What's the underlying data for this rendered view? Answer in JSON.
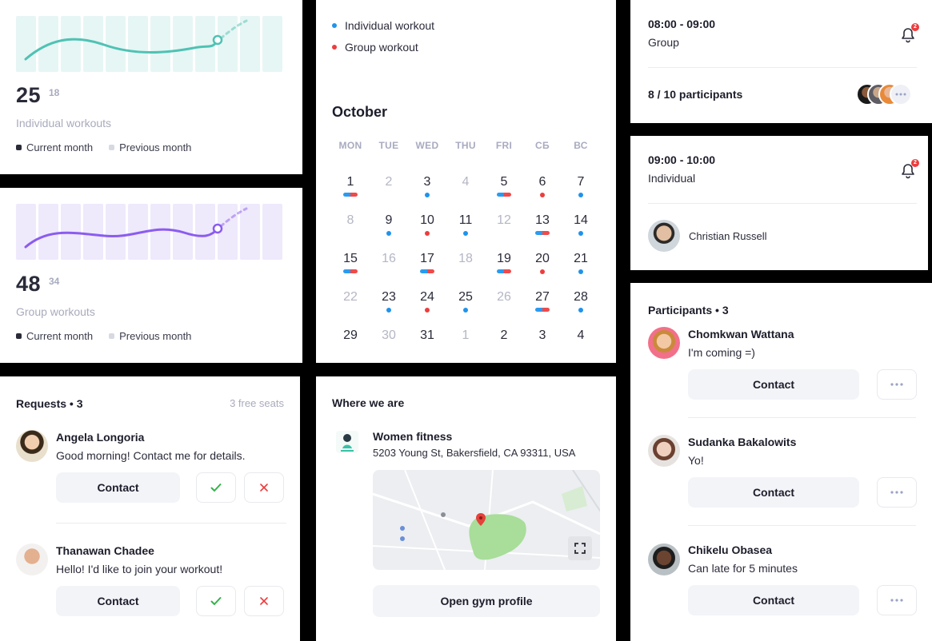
{
  "stats": [
    {
      "value": "25",
      "prev": "18",
      "label": "Individual workouts",
      "line_color": "#4fc2b4",
      "bar_color": "#e6f6f4"
    },
    {
      "value": "48",
      "prev": "34",
      "label": "Group workouts",
      "line_color": "#8b5cf0",
      "bar_color": "#efe9fc"
    }
  ],
  "legend": {
    "current": "Current month",
    "previous": "Previous month"
  },
  "calendar": {
    "legend": [
      {
        "label": "Individual workout",
        "color": "#1f93ec"
      },
      {
        "label": "Group workout",
        "color": "#ec3d3d"
      }
    ],
    "month": "October",
    "weekdays": [
      "MON",
      "TUE",
      "WED",
      "THU",
      "FRI",
      "СБ",
      "ВС"
    ],
    "weeks": [
      [
        {
          "d": "1",
          "m": "pill"
        },
        {
          "d": "2",
          "dim": true
        },
        {
          "d": "3",
          "m": "blue"
        },
        {
          "d": "4",
          "dim": true
        },
        {
          "d": "5",
          "m": "pill"
        },
        {
          "d": "6",
          "m": "red"
        },
        {
          "d": "7",
          "m": "blue"
        }
      ],
      [
        {
          "d": "8",
          "dim": true
        },
        {
          "d": "9",
          "m": "blue"
        },
        {
          "d": "10",
          "m": "red"
        },
        {
          "d": "11",
          "m": "blue"
        },
        {
          "d": "12",
          "dim": true
        },
        {
          "d": "13",
          "m": "pill"
        },
        {
          "d": "14",
          "m": "blue"
        }
      ],
      [
        {
          "d": "15",
          "m": "pill"
        },
        {
          "d": "16",
          "dim": true
        },
        {
          "d": "17",
          "m": "pill"
        },
        {
          "d": "18",
          "dim": true
        },
        {
          "d": "19",
          "m": "pill"
        },
        {
          "d": "20",
          "m": "red"
        },
        {
          "d": "21",
          "m": "blue"
        }
      ],
      [
        {
          "d": "22",
          "dim": true
        },
        {
          "d": "23",
          "m": "blue"
        },
        {
          "d": "24",
          "m": "red"
        },
        {
          "d": "25",
          "m": "blue"
        },
        {
          "d": "26",
          "dim": true
        },
        {
          "d": "27",
          "m": "pill"
        },
        {
          "d": "28",
          "m": "blue"
        }
      ],
      [
        {
          "d": "29"
        },
        {
          "d": "30",
          "dim": true
        },
        {
          "d": "31"
        },
        {
          "d": "1",
          "dim": true
        },
        {
          "d": "2"
        },
        {
          "d": "3"
        },
        {
          "d": "4"
        }
      ]
    ]
  },
  "sessions": [
    {
      "time": "08:00 - 09:00",
      "type": "Group",
      "badge": "2",
      "participants": "8 / 10 participants"
    },
    {
      "time": "09:00 - 10:00",
      "type": "Individual",
      "badge": "2",
      "person": "Christian Russell"
    }
  ],
  "requests": {
    "title": "Requests • 3",
    "seats": "3 free seats",
    "items": [
      {
        "name": "Angela Longoria",
        "msg": "Good morning! Contact me for details.",
        "contact": "Contact"
      },
      {
        "name": "Thanawan Chadee",
        "msg": "Hello! I'd like to join your workout!",
        "contact": "Contact"
      }
    ]
  },
  "location": {
    "title": "Where we are",
    "gym_name": "Women fitness",
    "address": "5203 Young St, Bakersfield, CA 93311, USA",
    "open_button": "Open gym profile"
  },
  "participants": {
    "title": "Participants • 3",
    "items": [
      {
        "name": "Chomkwan Wattana",
        "msg": "I'm coming =)",
        "contact": "Contact"
      },
      {
        "name": "Sudanka Bakalowits",
        "msg": "Yo!",
        "contact": "Contact"
      },
      {
        "name": "Chikelu Obasea",
        "msg": "Can late for 5 minutes",
        "contact": "Contact"
      }
    ]
  }
}
